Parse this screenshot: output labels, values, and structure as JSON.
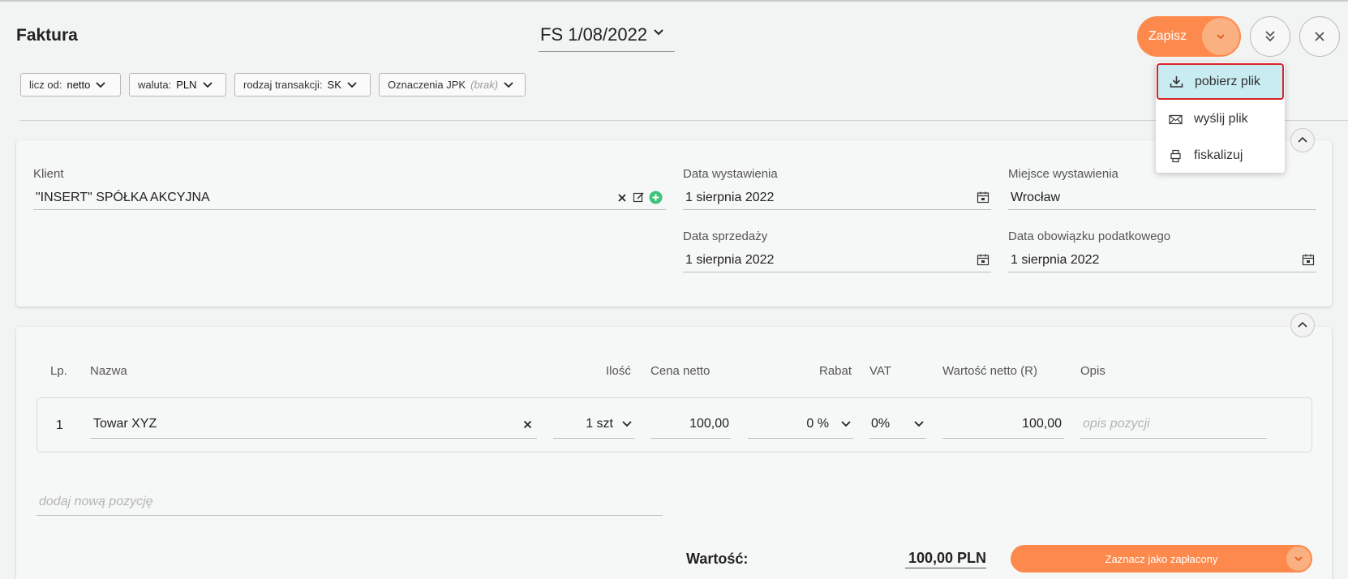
{
  "header": {
    "title": "Faktura",
    "doc_number": "FS 1/08/2022",
    "save_label": "Zapisz"
  },
  "filters": [
    {
      "label": "licz od:",
      "value": "netto"
    },
    {
      "label": "waluta:",
      "value": "PLN"
    },
    {
      "label": "rodzaj transakcji:",
      "value": "SK"
    },
    {
      "label": "Oznaczenia JPK",
      "value": "(brak)"
    }
  ],
  "menu": {
    "items": [
      {
        "label": "pobierz plik",
        "icon": "download-icon"
      },
      {
        "label": "wyślij plik",
        "icon": "envelope-icon"
      },
      {
        "label": "fiskalizuj",
        "icon": "printer-icon"
      }
    ]
  },
  "client": {
    "label": "Klient",
    "value": "\"INSERT\" SPÓŁKA AKCYJNA"
  },
  "dates": {
    "issue_label": "Data wystawienia",
    "issue_value": "1 sierpnia 2022",
    "place_label": "Miejsce wystawienia",
    "place_value": "Wrocław",
    "sale_label": "Data sprzedaży",
    "sale_value": "1 sierpnia 2022",
    "tax_label": "Data obowiązku podatkowego",
    "tax_value": "1 sierpnia 2022"
  },
  "table": {
    "headers": {
      "lp": "Lp.",
      "name": "Nazwa",
      "qty": "Ilość",
      "price": "Cena netto",
      "discount": "Rabat",
      "vat": "VAT",
      "net_value": "Wartość netto (R)",
      "desc": "Opis"
    },
    "row": {
      "lp": "1",
      "name": "Towar XYZ",
      "qty": "1 szt",
      "price": "100,00",
      "discount": "0 %",
      "vat": "0%",
      "net_value": "100,00",
      "desc_placeholder": "opis pozycji"
    },
    "add_placeholder": "dodaj nową pozycję"
  },
  "summary": {
    "label": "Wartość:",
    "value": "100,00 PLN",
    "paid_button": "Zaznacz jako zapłacony"
  },
  "colors": {
    "accent": "#fd8a4c",
    "accent_light": "#fbb082",
    "highlight": "#c9ecf2",
    "highlight_border": "#d9222a"
  }
}
